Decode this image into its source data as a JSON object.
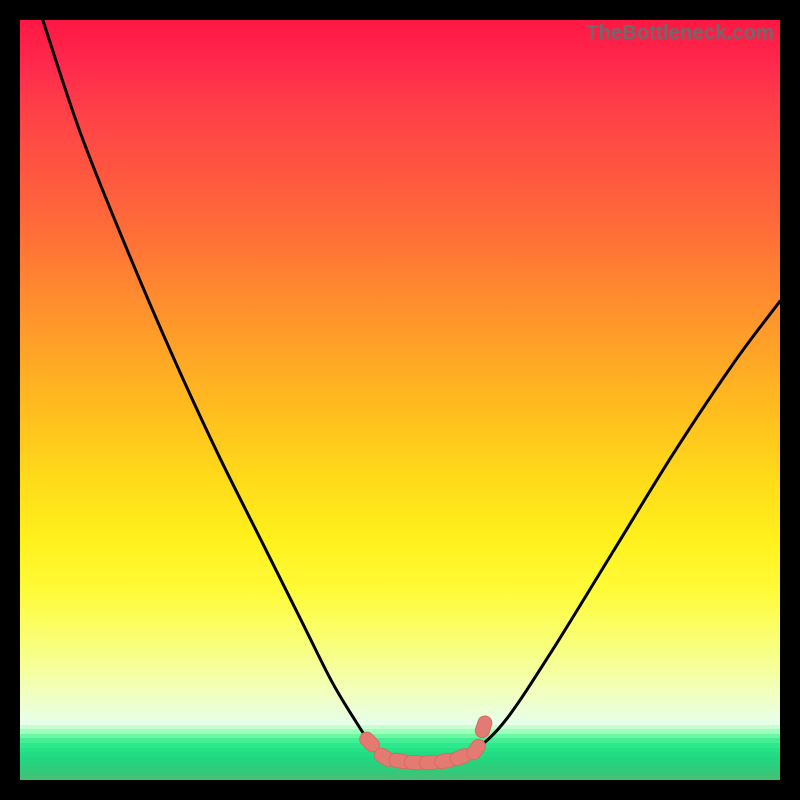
{
  "watermark": "TheBottleneck.com",
  "colors": {
    "page_bg": "#000000",
    "gradient_top": "#ff1744",
    "gradient_mid": "#ffd400",
    "gradient_low": "#ffffcc",
    "band_green": "#2ef58a",
    "curve_stroke": "#000000",
    "marker_fill": "#e37b73",
    "marker_stroke": "#d86b63"
  },
  "chart_data": {
    "type": "line",
    "title": "",
    "xlabel": "",
    "ylabel": "",
    "xlim": [
      0,
      100
    ],
    "ylim": [
      0,
      100
    ],
    "note": "No axis ticks or numeric labels are rendered in the image; values below are geometric estimates read off the plot area, where x and y are percentages of the inner plot width/height (0 = left/bottom, 100 = right/top).",
    "series": [
      {
        "name": "left-branch",
        "x": [
          3,
          8,
          14,
          20,
          26,
          32,
          37,
          41,
          44,
          46,
          48
        ],
        "y": [
          100,
          85,
          70,
          56,
          43,
          31,
          21,
          13,
          8,
          5,
          3
        ]
      },
      {
        "name": "valley-floor",
        "x": [
          48,
          50,
          52,
          54,
          56,
          58,
          60
        ],
        "y": [
          3,
          2.5,
          2.3,
          2.3,
          2.5,
          3,
          4
        ]
      },
      {
        "name": "right-branch",
        "x": [
          60,
          64,
          70,
          78,
          86,
          94,
          100
        ],
        "y": [
          4,
          8,
          17,
          30,
          43,
          55,
          63
        ]
      }
    ],
    "markers": {
      "name": "highlighted-points",
      "shape": "rounded-capsule",
      "x": [
        46,
        48,
        50,
        52,
        54,
        56,
        58,
        60,
        61
      ],
      "y": [
        5,
        3,
        2.5,
        2.3,
        2.3,
        2.5,
        3,
        4,
        7
      ]
    },
    "bottom_band_stripes": [
      "#e8ffe8",
      "#c6ffd2",
      "#9dffb9",
      "#6cf7a2",
      "#43ee94",
      "#2ee88c",
      "#24e286",
      "#21dc82",
      "#22d77f",
      "#26d27d",
      "#2ecc7b",
      "#38c679",
      "#44c077"
    ]
  }
}
